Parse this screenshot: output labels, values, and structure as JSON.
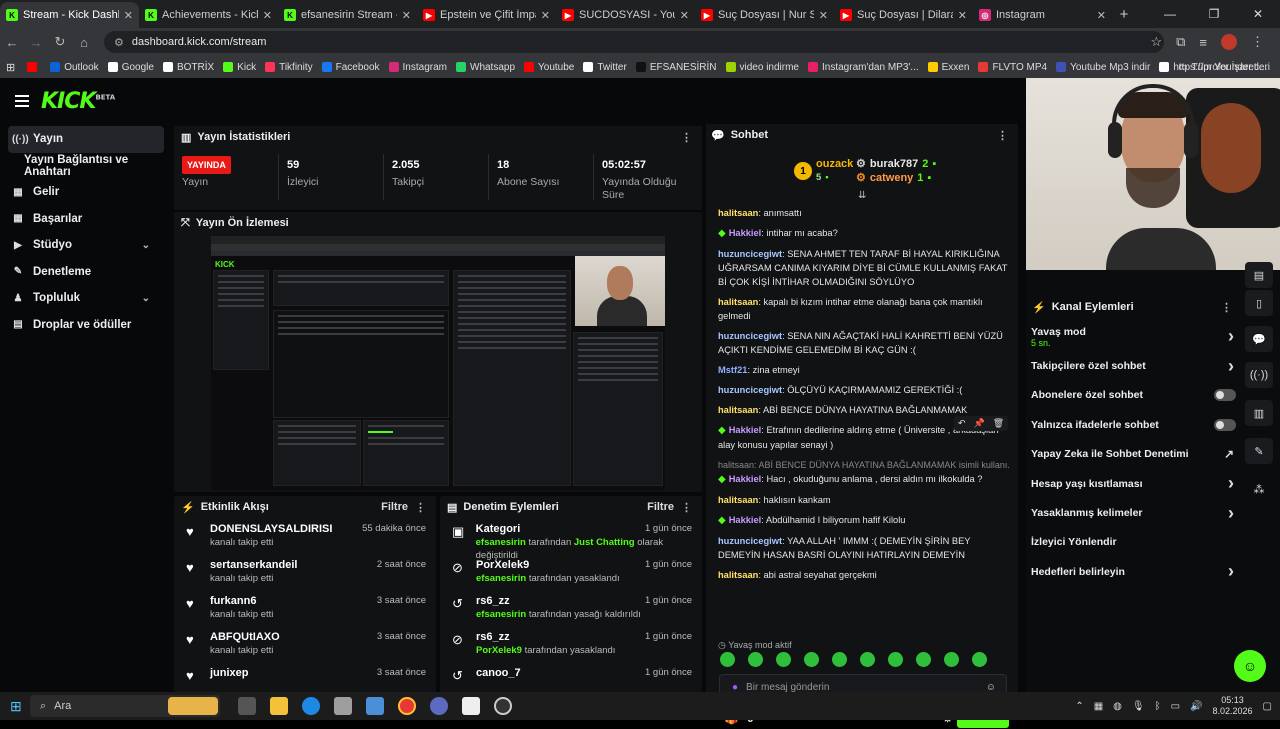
{
  "browser": {
    "tabs": [
      {
        "label": "Stream - Kick Dashboard",
        "color": "#53fc18",
        "glyph": "K",
        "active": true
      },
      {
        "label": "Achievements - Kick Da",
        "color": "#53fc18",
        "glyph": "K"
      },
      {
        "label": "efsanesirin Stream - Watc",
        "color": "#53fc18",
        "glyph": "K"
      },
      {
        "label": "Epstein ve Çifit İmparator",
        "color": "#ff0000",
        "glyph": "▶"
      },
      {
        "label": "SUCDOSYASI - YouTube",
        "color": "#ff0000",
        "glyph": "▶"
      },
      {
        "label": "Suç Dosyası | Nur Sena D",
        "color": "#ff0000",
        "glyph": "▶"
      },
      {
        "label": "Suç Dosyası | Dilara ALDA",
        "color": "#ff0000",
        "glyph": "▶"
      },
      {
        "label": "Instagram",
        "color": "#d62976",
        "glyph": "◎"
      }
    ],
    "url": "dashboard.kick.com/stream",
    "bookmarks": [
      {
        "label": "",
        "color": "#ff0000"
      },
      {
        "label": "Outlook",
        "color": "#0a64d6"
      },
      {
        "label": "Google",
        "color": "#ffffff"
      },
      {
        "label": "BOTRİX",
        "color": "#ffffff"
      },
      {
        "label": "Kick",
        "color": "#53fc18"
      },
      {
        "label": "Tikfinity",
        "color": "#ff3355"
      },
      {
        "label": "Facebook",
        "color": "#1877f2"
      },
      {
        "label": "Instagram",
        "color": "#d62976"
      },
      {
        "label": "Whatsapp",
        "color": "#25d366"
      },
      {
        "label": "Youtube",
        "color": "#ff0000"
      },
      {
        "label": "Twitter",
        "color": "#ffffff"
      },
      {
        "label": "EFSANESİRİN",
        "color": "#111111"
      },
      {
        "label": "video indirme",
        "color": "#9bd400"
      },
      {
        "label": "Instagram'dan MP3'...",
        "color": "#e91e63"
      },
      {
        "label": "Exxen",
        "color": "#ffcc00"
      },
      {
        "label": "FLVTO MP4",
        "color": "#e53935"
      },
      {
        "label": "Youtube Mp3 indir",
        "color": "#3f51b5"
      },
      {
        "label": "https://profounder.c...",
        "color": "#ffffff"
      }
    ],
    "bookmarks_right": "Tüm Yer İşaretleri"
  },
  "sidebar": {
    "items": [
      {
        "label": "Yayın",
        "icon": "broadcast-icon",
        "glyph": "((·))",
        "active": true
      },
      {
        "label": "Yayın Bağlantısı ve Anahtarı",
        "icon": "",
        "glyph": "",
        "sub": true
      },
      {
        "label": "Gelir",
        "icon": "chart-icon",
        "glyph": "▦"
      },
      {
        "label": "Başarılar",
        "icon": "trophy-icon",
        "glyph": "▦"
      },
      {
        "label": "Stüdyo",
        "icon": "studio-icon",
        "glyph": "▶",
        "chev": true
      },
      {
        "label": "Denetleme",
        "icon": "wrench-icon",
        "glyph": "✎"
      },
      {
        "label": "Topluluk",
        "icon": "community-icon",
        "glyph": "♟",
        "chev": true
      },
      {
        "label": "Droplar ve ödüller",
        "icon": "gift-icon",
        "glyph": "▤"
      }
    ]
  },
  "stats": {
    "title": "Yayın İstatistikleri",
    "live_badge": "YAYINDA",
    "items": [
      {
        "value": "",
        "label": "Yayın"
      },
      {
        "value": "59",
        "label": "İzleyici"
      },
      {
        "value": "2.055",
        "label": "Takipçi"
      },
      {
        "value": "18",
        "label": "Abone Sayısı"
      },
      {
        "value": "05:02:57",
        "label": "Yayında Olduğu Süre"
      }
    ]
  },
  "preview": {
    "title": "Yayın Ön İzlemesi"
  },
  "activity": {
    "title": "Etkinlik Akışı",
    "filter": "Filtre",
    "items": [
      {
        "name": "DONENSLAYSALDIRISI",
        "sub": "kanalı takip etti",
        "time": "55 dakika önce"
      },
      {
        "name": "sertanserkandeil",
        "sub": "kanalı takip etti",
        "time": "2 saat önce"
      },
      {
        "name": "furkann6",
        "sub": "kanalı takip etti",
        "time": "3 saat önce"
      },
      {
        "name": "ABFQUtIAXO",
        "sub": "kanalı takip etti",
        "time": "3 saat önce"
      },
      {
        "name": "junixep",
        "sub": "",
        "time": "3 saat önce"
      }
    ]
  },
  "moderation": {
    "title": "Denetim Eylemleri",
    "filter": "Filtre",
    "items": [
      {
        "name": "Kategori",
        "actor": "efsanesirin",
        "mid": "tarafından",
        "hl": "Just Chatting",
        "rest": "olarak değiştirildi",
        "time": "1 gün önce",
        "glyph": "▣"
      },
      {
        "name": "PorXelek9",
        "actor": "efsanesirin",
        "mid": "tarafından yasaklandı",
        "hl": "",
        "rest": "",
        "time": "1 gün önce",
        "glyph": "⊘"
      },
      {
        "name": "rs6_zz",
        "actor": "efsanesirin",
        "mid": "tarafından yasağı kaldırıldı",
        "hl": "",
        "rest": "",
        "time": "1 gün önce",
        "glyph": "↺"
      },
      {
        "name": "rs6_zz",
        "actor": "PorXelek9",
        "mid": "tarafından yasaklandı",
        "hl": "",
        "rest": "",
        "time": "1 gün önce",
        "glyph": "⊘"
      },
      {
        "name": "canoo_7",
        "actor": "",
        "mid": "",
        "hl": "",
        "rest": "",
        "time": "1 gün önce",
        "glyph": "↺"
      }
    ]
  },
  "chat": {
    "title": "Sohbet",
    "top": [
      {
        "name": "ouzack",
        "count": "5"
      },
      {
        "name": "burak787",
        "count": "2"
      },
      {
        "name": "catweny",
        "count": "1"
      }
    ],
    "top_rank": "1",
    "messages": [
      {
        "user": "halitsaan",
        "text": "anımsattı",
        "cls": "ye",
        "gem": false
      },
      {
        "user": "Hakkiel",
        "text": "intihar mı acaba?",
        "cls": "pu",
        "gem": true
      },
      {
        "user": "huzuncicegiwt",
        "text": "SENA AHMET TEN TARAF Bİ HAYAL KIRIKLIĞINA UĞRARSAM CANIMA KIYARIM DİYE Bİ CÜMLE KULLANMIŞ FAKAT Bİ ÇOK KİŞİ İNTİHAR OLMADIĞINI SÖYLÜYO",
        "cls": "cy",
        "gem": false
      },
      {
        "user": "halitsaan",
        "text": "kapalı bi kızım intihar etme olanağı bana çok mantıklı gelmedi",
        "cls": "ye",
        "gem": false
      },
      {
        "user": "huzuncicegiwt",
        "text": "SENA NIN AĞAÇTAKİ HALİ KAHRETTİ BENİ YÜZÜ AÇIKTI KENDİME GELEMEDİM Bİ KAÇ GÜN :(",
        "cls": "cy",
        "gem": false
      },
      {
        "user": "Mstf21",
        "text": "zina etmeyi",
        "cls": "bl",
        "gem": false
      },
      {
        "user": "huzuncicegiwt",
        "text": "ÖLÇÜYÜ KAÇIRMAMAMIZ GEREKTİĞİ :(",
        "cls": "cy",
        "gem": false
      },
      {
        "user": "halitsaan",
        "text": "ABİ BENCE DÜNYA HAYATINA BAĞLANMAMAK",
        "cls": "ye",
        "gem": false
      },
      {
        "user": "Hakkiel",
        "text": "Etrafının dedilerine aldırış etme ( Üniversite , arkadaşları alay konusu yapılar senayi )",
        "cls": "pu",
        "gem": true
      },
      {
        "user": "Hakkiel",
        "text": "Hacı , okuduğunu anlama , dersi aldın mı ilkokulda ?",
        "cls": "pu",
        "gem": true,
        "reply": "halitsaan: ABİ BENCE DÜNYA HAYATINA BAĞLANMAMAK isimli kullanı..."
      },
      {
        "user": "halitsaan",
        "text": "haklısın kankam",
        "cls": "ye",
        "gem": false
      },
      {
        "user": "Hakkiel",
        "text": "Abdülhamid I biliyorum hafif Kilolu",
        "cls": "pu",
        "gem": true
      },
      {
        "user": "huzuncicegiwt",
        "text": "YAA ALLAH ' IMMM :( DEMEYİN ŞİRİN BEY DEMEYİN HASAN BASRİ OLAYINI HATIRLAYIN DEMEYİN",
        "cls": "cy",
        "gem": false
      },
      {
        "user": "halitsaan",
        "text": "abi astral seyahat gerçekmi",
        "cls": "ye",
        "gem": false
      }
    ],
    "slow_notice": "Yavaş mod aktif",
    "placeholder": "Bir mesaj gönderin",
    "points": "0",
    "send": "Gönder"
  },
  "channel_actions": {
    "title": "Kanal Eylemleri",
    "items": [
      {
        "label": "Yavaş mod",
        "sub": "5 sn.",
        "kind": "arrow"
      },
      {
        "label": "Takipçilere özel sohbet",
        "kind": "arrow"
      },
      {
        "label": "Abonelere özel sohbet",
        "kind": "toggle"
      },
      {
        "label": "Yalnızca ifadelerle sohbet",
        "kind": "toggle"
      },
      {
        "label": "Yapay Zeka ile Sohbet Denetimi",
        "kind": "external"
      },
      {
        "label": "Hesap yaşı kısıtlaması",
        "kind": "arrow"
      },
      {
        "label": "Yasaklanmış kelimeler",
        "kind": "arrow"
      },
      {
        "label": "İzleyici Yönlendir",
        "kind": "none"
      },
      {
        "label": "Hedefleri belirleyin",
        "kind": "arrow"
      }
    ]
  },
  "taskbar": {
    "search": "Ara",
    "time": "05:13",
    "date": "8.02.2026"
  }
}
